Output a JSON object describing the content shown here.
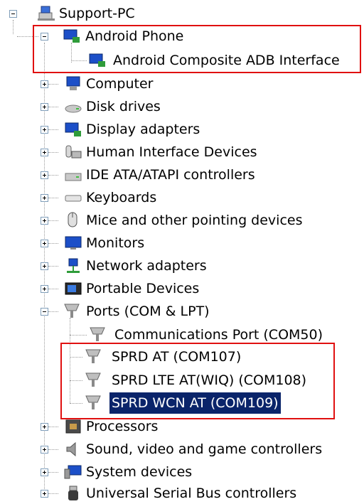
{
  "tree": {
    "root": {
      "label": "Support-PC",
      "icon": "computer-network-icon"
    },
    "android": {
      "label": "Android Phone",
      "icon": "phone-icon",
      "child": {
        "label": "Android Composite ADB Interface",
        "icon": "adb-device-icon"
      }
    },
    "categories": [
      {
        "label": "Computer",
        "icon": "computer-icon"
      },
      {
        "label": "Disk drives",
        "icon": "disk-drive-icon"
      },
      {
        "label": "Display adapters",
        "icon": "display-adapter-icon"
      },
      {
        "label": "Human Interface Devices",
        "icon": "hid-icon"
      },
      {
        "label": "IDE ATA/ATAPI controllers",
        "icon": "ide-controller-icon"
      },
      {
        "label": "Keyboards",
        "icon": "keyboard-icon"
      },
      {
        "label": "Mice and other pointing devices",
        "icon": "mouse-icon"
      },
      {
        "label": "Monitors",
        "icon": "monitor-icon"
      },
      {
        "label": "Network adapters",
        "icon": "network-adapter-icon"
      },
      {
        "label": "Portable Devices",
        "icon": "portable-device-icon"
      }
    ],
    "ports": {
      "label": "Ports (COM & LPT)",
      "icon": "port-icon",
      "children": [
        {
          "label": "Communications Port (COM50)",
          "icon": "port-icon"
        },
        {
          "label": "SPRD AT (COM107)",
          "icon": "port-icon"
        },
        {
          "label": "SPRD LTE AT(WIQ) (COM108)",
          "icon": "port-icon"
        },
        {
          "label": "SPRD WCN AT (COM109)",
          "icon": "port-icon",
          "selected": true
        }
      ]
    },
    "after": [
      {
        "label": "Processors",
        "icon": "processor-icon"
      },
      {
        "label": "Sound, video and game controllers",
        "icon": "speaker-icon"
      },
      {
        "label": "System devices",
        "icon": "system-devices-icon"
      },
      {
        "label": "Universal Serial Bus controllers",
        "icon": "usb-icon"
      }
    ]
  },
  "colors": {
    "highlight_box": "#e01010",
    "selection_bg": "#0a246a"
  }
}
